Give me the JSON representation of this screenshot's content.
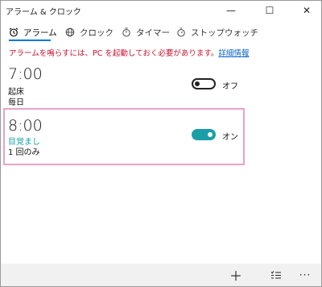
{
  "window": {
    "title": "アラーム & クロック",
    "controls": {
      "minimize": "—",
      "maximize": "☐",
      "close": "✕"
    }
  },
  "tabs": [
    {
      "label": "アラーム",
      "icon": "alarm-clock-icon",
      "selected": true
    },
    {
      "label": "クロック",
      "icon": "world-clock-icon",
      "selected": false
    },
    {
      "label": "タイマー",
      "icon": "timer-icon",
      "selected": false
    },
    {
      "label": "ストップウォッチ",
      "icon": "stopwatch-icon",
      "selected": false
    }
  ],
  "notice": {
    "text": "アラームを鳴らすには、PC を起動しておく必要があります。",
    "link": "詳細情報"
  },
  "alarms": [
    {
      "time": "7:00",
      "name": "起床",
      "repeat": "毎日",
      "enabled": false,
      "toggle_label": "オフ"
    },
    {
      "time": "8:00",
      "name": "目覚まし",
      "repeat": "1 回のみ",
      "enabled": true,
      "toggle_label": "オン"
    }
  ],
  "colors": {
    "accent": "#0078d7",
    "toggle_on": "#1a9fa9",
    "name_highlight": "#1a9fa9",
    "notice": "#c8102e",
    "link": "#0a63c9",
    "selection_frame": "#e8a3c5"
  },
  "bottom_bar": {
    "add": "＋",
    "select": "select-list-icon",
    "more": "···"
  }
}
